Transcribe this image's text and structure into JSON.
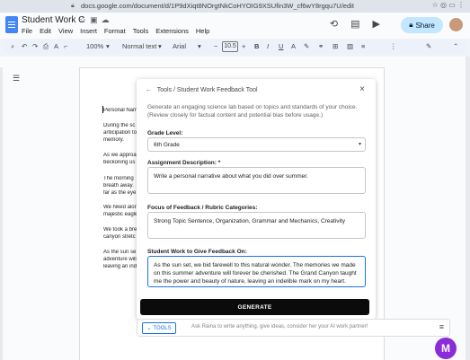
{
  "browser": {
    "url": "docs.google.com/document/d/1P9dXiqt8NOrgtNkCoHYOIG9XSUfin3W_cf6wY8rgqu7U/edit"
  },
  "doc": {
    "title": "Student Work C",
    "menu": [
      "File",
      "Edit",
      "View",
      "Insert",
      "Format",
      "Tools",
      "Extensions",
      "Help"
    ],
    "share_label": "Share"
  },
  "toolbar": {
    "zoom": "100%",
    "style": "Normal text",
    "font": "Arial",
    "size": "10.5"
  },
  "doc_lines": [
    "Personal Narr",
    "During the sc",
    "anticipation to",
    "memory.",
    "As we approa",
    "beckoning us",
    "The morning",
    "breath away.",
    "far as the eye",
    "We hiked alor",
    "majestic eagle",
    "We took a bre",
    "canyon stretc",
    "As the sun se",
    "adventure will",
    "leaving an ind"
  ],
  "panel": {
    "breadcrumb_root": "Tools",
    "breadcrumb_sep": "/",
    "breadcrumb_current": "Student Work Feedback Tool",
    "description": "Generate an engaging science lab based on topics and standards of your choice. (Review closely for factual content and potential bias before usage.)",
    "grade_label": "Grade Level:",
    "grade_value": "6th Grade",
    "assignment_label": "Assignment Description: *",
    "assignment_value": "Write a personal narrative about what you did over summer.",
    "focus_label": "Focus of Feedback / Rubric Categories:",
    "focus_value": "Strong Topic Sentence, Organization, Grammar and Mechanics, Creativity",
    "student_label": "Student Work to Give Feedback On:",
    "student_value": "As the sun set, we bid farewell to this natural wonder. The memories we made on this summer adventure will forever be cherished. The Grand Canyon taught me the power and beauty of nature, leaving an indelible mark on my heart.",
    "generate_label": "GENERATE"
  },
  "bottombar": {
    "tools_label": "TOOLS",
    "ask_placeholder": "Ask Raina to write anything, give ideas, consider her your AI work partner!"
  },
  "logo_letter": "M",
  "colors": {
    "accent": "#1a73e8",
    "share_bg": "#c2e7ff",
    "generate_bg": "#0b0b0b",
    "magic_purple": "#8b2bd9"
  }
}
